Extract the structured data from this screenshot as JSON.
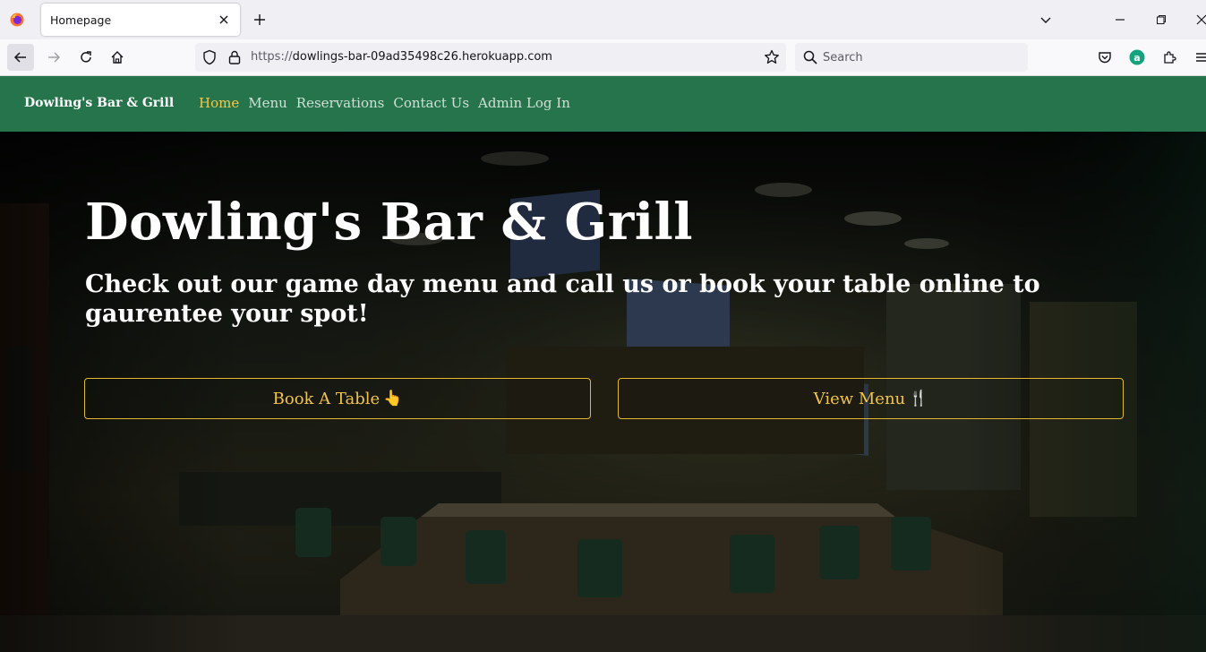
{
  "browser": {
    "tab_title": "Homepage",
    "url_prefix": "https://",
    "url_host": "dowlings-bar-09ad35498c26.herokuapp.com",
    "search_placeholder": "Search"
  },
  "site": {
    "brand": "Dowling's Bar & Grill",
    "nav": [
      {
        "label": "Home",
        "active": true
      },
      {
        "label": "Menu",
        "active": false
      },
      {
        "label": "Reservations",
        "active": false
      },
      {
        "label": "Contact Us",
        "active": false
      },
      {
        "label": "Admin Log In",
        "active": false
      }
    ]
  },
  "hero": {
    "title": "Dowling's Bar & Grill",
    "subtitle": "Check out our game day menu and call us or book your table online to gaurentee your spot!",
    "book_button": "Book A Table",
    "book_icon": "👆",
    "menu_button": "View Menu",
    "menu_icon": "🍴"
  },
  "colors": {
    "nav_green": "#25744b",
    "accent_gold": "#f3c44a",
    "active_link": "#f3c94b"
  }
}
